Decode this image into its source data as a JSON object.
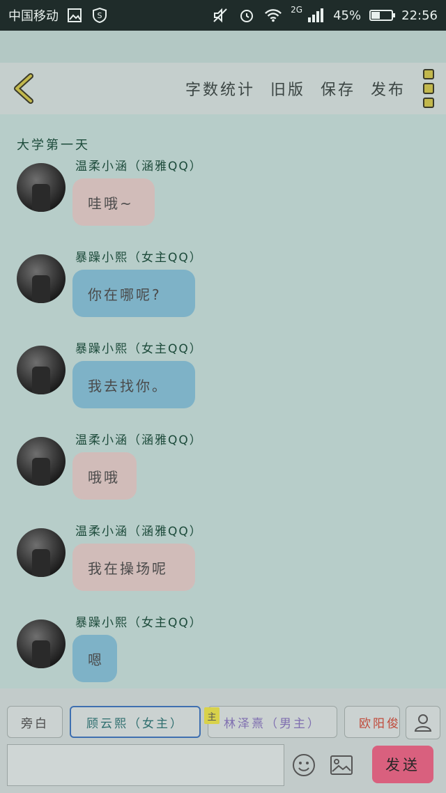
{
  "status_bar": {
    "carrier": "中国移动",
    "network": "2G",
    "battery_percent": "45%",
    "battery_level": 0.45,
    "time": "22:56",
    "icons": [
      "image-icon",
      "shield-s-icon",
      "mute-icon",
      "alarm-icon",
      "wifi-icon",
      "signal-icon",
      "battery-icon"
    ]
  },
  "toolbar": {
    "back_icon": "chevron-left-icon",
    "word_count": "字数统计",
    "old_version": "旧版",
    "save": "保存",
    "publish": "发布",
    "more_icon": "more-vertical-icon"
  },
  "chat": {
    "title": "大学第一天",
    "messages": [
      {
        "sender": "温柔小涵（涵雅QQ）",
        "text": "哇哦~",
        "bubble": "pink"
      },
      {
        "sender": "暴躁小熙（女主QQ）",
        "text": "你在哪呢?",
        "bubble": "blue"
      },
      {
        "sender": "暴躁小熙（女主QQ）",
        "text": "我去找你。",
        "bubble": "blue"
      },
      {
        "sender": "温柔小涵（涵雅QQ）",
        "text": "哦哦",
        "bubble": "pink"
      },
      {
        "sender": "温柔小涵（涵雅QQ）",
        "text": "我在操场呢",
        "bubble": "pink"
      },
      {
        "sender": "暴躁小熙（女主QQ）",
        "text": "嗯",
        "bubble": "blue"
      }
    ]
  },
  "bottom": {
    "roles": [
      "旁白",
      "顾云熙（女主）",
      "林泽熹（男主）",
      "欧阳俊"
    ],
    "main_tag": "主",
    "person_icon": "person-icon",
    "input_placeholder": "",
    "emoji_icon": "smiley-icon",
    "image_icon": "picture-icon",
    "send": "发送"
  },
  "colors": {
    "background": "#b7cdc9",
    "pink_bubble": "#d1bcb9",
    "blue_bubble": "#7eb2c7",
    "send_button": "#d9607e",
    "active_role_border": "#3e6fb0"
  }
}
